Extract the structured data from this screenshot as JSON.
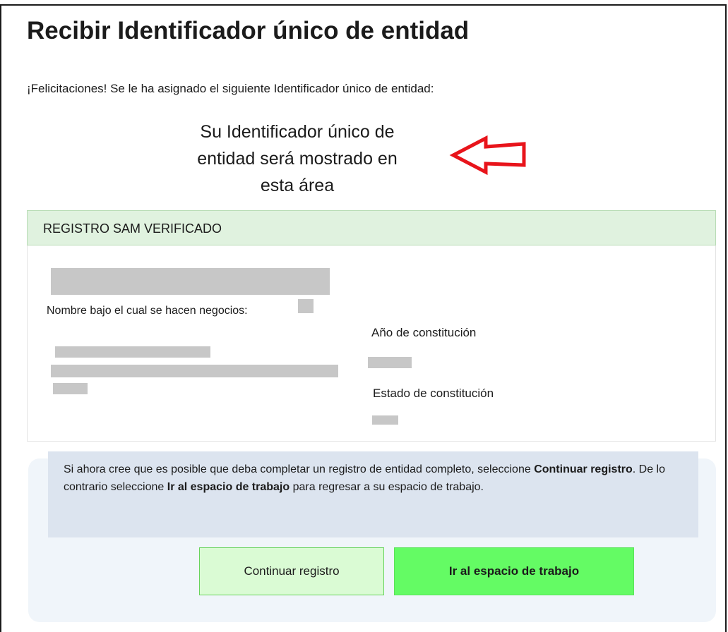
{
  "page": {
    "title": "Recibir Identificador único de entidad",
    "congrats_message": "¡Felicitaciones! Se le ha asignado el siguiente Identificador único de entidad:",
    "uei_placeholder_lines": [
      "Su Identificador único de",
      "entidad será mostrado en",
      "esta área"
    ],
    "arrow_color": "#e8141b"
  },
  "registration": {
    "header": "REGISTRO SAM VERIFICADO",
    "header_bg": "#e0f2df",
    "dba_label": "Nombre bajo el cual se hacen negocios:",
    "year_label": "Año de constitución",
    "state_label": "Estado de constitución"
  },
  "actions": {
    "info_prefix": "Si ahora cree que es posible que deba completar un registro de entidad completo, seleccione ",
    "info_bold_1": "Continuar registro",
    "info_middle": ". De lo contrario seleccione ",
    "info_bold_2": "Ir al espacio de trabajo",
    "info_suffix": " para regresar a su espacio de trabajo.",
    "continue_label": "Continuar registro",
    "workspace_label": "Ir al espacio de trabajo",
    "workspace_color": "#64fb64",
    "continue_color": "#dafbd4"
  }
}
